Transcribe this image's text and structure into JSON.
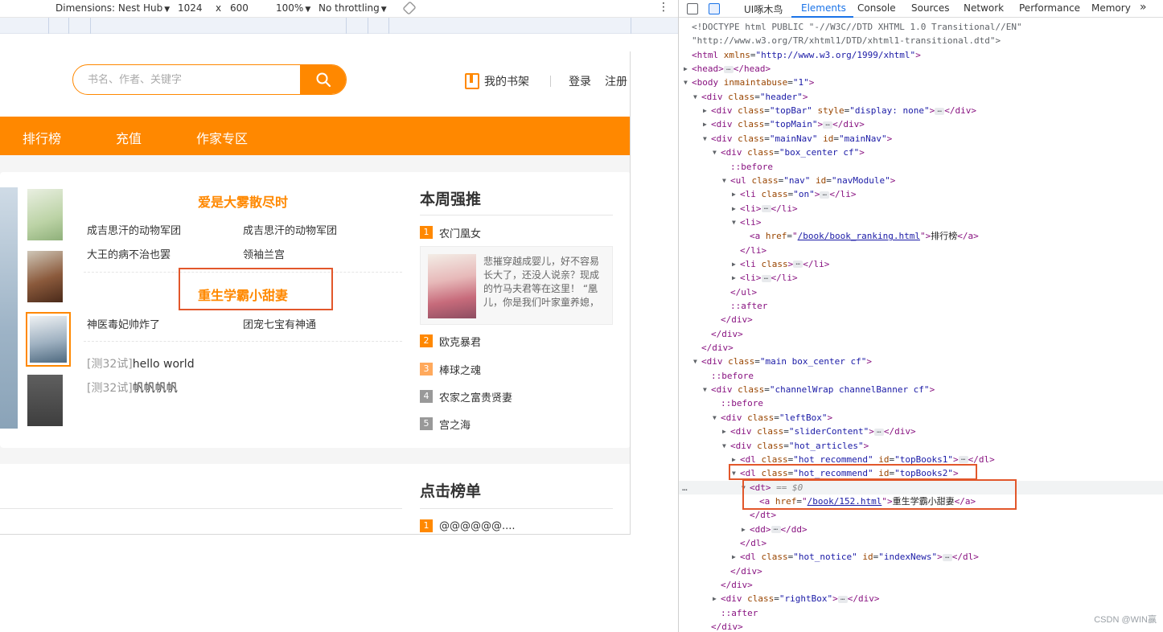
{
  "device_toolbar": {
    "dimensions_label": "Dimensions: Nest Hub",
    "width": "1024",
    "times": "x",
    "height": "600",
    "zoom": "100%",
    "throttling": "No throttling",
    "more": "⋮"
  },
  "site": {
    "search_placeholder": "书名、作者、关键字",
    "bookshelf_label": "我的书架",
    "login_label": "登录",
    "register_label": "注册",
    "nav": [
      {
        "label": "排行榜"
      },
      {
        "label": "充值"
      },
      {
        "label": "作家专区"
      }
    ],
    "hot_recommend_1": {
      "title": "爱是大雾散尽时",
      "books": [
        "成吉思汗的动物军团",
        "成吉思汗的动物军团",
        "大王的病不治也罢",
        "领袖兰宫"
      ]
    },
    "hot_recommend_2": {
      "title": "重生学霸小甜妻",
      "books": [
        "神医毒妃帅炸了",
        "团宠七宝有神通"
      ]
    },
    "notices": [
      {
        "tag": "[测32试]",
        "text": "hello world"
      },
      {
        "tag": "[测32试]",
        "text": "帆帆帆帆"
      }
    ],
    "weekly_recommend": {
      "title": "本周强推",
      "items": [
        {
          "rank": "1",
          "name": "农门凰女"
        },
        {
          "rank": "2",
          "name": "欧克暴君"
        },
        {
          "rank": "3",
          "name": "棒球之魂"
        },
        {
          "rank": "4",
          "name": "农家之富贵贤妻"
        },
        {
          "rank": "5",
          "name": "宫之海"
        }
      ],
      "feature_desc": "悲摧穿越成婴儿，好不容易长大了，还没人说亲？现成的竹马夫君等在这里！ “凰儿，你是我们叶家童养媳，"
    },
    "click_rank": {
      "title": "点击榜单",
      "items": [
        {
          "rank": "1",
          "name": "@@@@@@...."
        }
      ]
    }
  },
  "devtools": {
    "tabs": [
      "UI啄木鸟",
      "Elements",
      "Console",
      "Sources",
      "Network",
      "Performance",
      "Memory"
    ],
    "more_tabs": "»",
    "lines": [
      {
        "i": 0,
        "a": "",
        "h": "<span class='doc-c'>&lt;!DOCTYPE html PUBLIC \"-//W3C//DTD XHTML 1.0 Transitional//EN\"</span>"
      },
      {
        "i": 0,
        "a": "",
        "h": "<span class='doc-c'>\"http://www.w3.org/TR/xhtml1/DTD/xhtml1-transitional.dtd\"&gt;</span>"
      },
      {
        "i": 0,
        "a": "",
        "h": "<span class='tag-c'>&lt;html</span> <span class='attr-n'>xmlns</span>=<span class='attr-v'>\"http://www.w3.org/1999/xhtml\"</span><span class='tag-c'>&gt;</span>"
      },
      {
        "i": 0,
        "a": "▶",
        "h": "<span class='tag-c'>&lt;head&gt;</span><span class='ell'>…</span><span class='tag-c'>&lt;/head&gt;</span>"
      },
      {
        "i": 0,
        "a": "▼",
        "h": "<span class='tag-c'>&lt;body</span> <span class='attr-n'>inmaintabuse</span>=<span class='attr-v'>\"1\"</span><span class='tag-c'>&gt;</span>"
      },
      {
        "i": 1,
        "a": "▼",
        "h": "<span class='tag-c'>&lt;div</span> <span class='attr-n'>class</span>=<span class='attr-v'>\"header\"</span><span class='tag-c'>&gt;</span>"
      },
      {
        "i": 2,
        "a": "▶",
        "h": "<span class='tag-c'>&lt;div</span> <span class='attr-n'>class</span>=<span class='attr-v'>\"topBar\"</span> <span class='attr-n'>style</span>=<span class='attr-v'>\"display: none\"</span><span class='tag-c'>&gt;</span><span class='ell'>…</span><span class='tag-c'>&lt;/div&gt;</span>"
      },
      {
        "i": 2,
        "a": "▶",
        "h": "<span class='tag-c'>&lt;div</span> <span class='attr-n'>class</span>=<span class='attr-v'>\"topMain\"</span><span class='tag-c'>&gt;</span><span class='ell'>…</span><span class='tag-c'>&lt;/div&gt;</span>"
      },
      {
        "i": 2,
        "a": "▼",
        "h": "<span class='tag-c'>&lt;div</span> <span class='attr-n'>class</span>=<span class='attr-v'>\"mainNav\"</span> <span class='attr-n'>id</span>=<span class='attr-v'>\"mainNav\"</span><span class='tag-c'>&gt;</span>"
      },
      {
        "i": 3,
        "a": "▼",
        "h": "<span class='tag-c'>&lt;div</span> <span class='attr-n'>class</span>=<span class='attr-v'>\"box_center cf\"</span><span class='tag-c'>&gt;</span>"
      },
      {
        "i": 4,
        "a": "",
        "h": "<span class='pseudo'>::before</span>"
      },
      {
        "i": 4,
        "a": "▼",
        "h": "<span class='tag-c'>&lt;ul</span> <span class='attr-n'>class</span>=<span class='attr-v'>\"nav\"</span> <span class='attr-n'>id</span>=<span class='attr-v'>\"navModule\"</span><span class='tag-c'>&gt;</span>"
      },
      {
        "i": 5,
        "a": "▶",
        "h": "<span class='tag-c'>&lt;li</span> <span class='attr-n'>class</span>=<span class='attr-v'>\"on\"</span><span class='tag-c'>&gt;</span><span class='ell'>…</span><span class='tag-c'>&lt;/li&gt;</span>"
      },
      {
        "i": 5,
        "a": "▶",
        "h": "<span class='tag-c'>&lt;li&gt;</span><span class='ell'>…</span><span class='tag-c'>&lt;/li&gt;</span>"
      },
      {
        "i": 5,
        "a": "▼",
        "h": "<span class='tag-c'>&lt;li&gt;</span>"
      },
      {
        "i": 6,
        "a": "",
        "h": "<span class='tag-c'>&lt;a</span> <span class='attr-n'>href</span>=<span class='tag-c'>\"</span><span class='link-c'>/book/book_ranking.html</span><span class='tag-c'>\"&gt;</span><span class='plain-c'>排行榜</span><span class='tag-c'>&lt;/a&gt;</span>"
      },
      {
        "i": 5,
        "a": "",
        "h": "<span class='tag-c'>&lt;/li&gt;</span>"
      },
      {
        "i": 5,
        "a": "▶",
        "h": "<span class='tag-c'>&lt;li</span> <span class='attr-n'>class</span><span class='tag-c'>&gt;</span><span class='ell'>…</span><span class='tag-c'>&lt;/li&gt;</span>"
      },
      {
        "i": 5,
        "a": "▶",
        "h": "<span class='tag-c'>&lt;li&gt;</span><span class='ell'>…</span><span class='tag-c'>&lt;/li&gt;</span>"
      },
      {
        "i": 4,
        "a": "",
        "h": "<span class='tag-c'>&lt;/ul&gt;</span>"
      },
      {
        "i": 4,
        "a": "",
        "h": "<span class='pseudo'>::after</span>"
      },
      {
        "i": 3,
        "a": "",
        "h": "<span class='tag-c'>&lt;/div&gt;</span>"
      },
      {
        "i": 2,
        "a": "",
        "h": "<span class='tag-c'>&lt;/div&gt;</span>"
      },
      {
        "i": 1,
        "a": "",
        "h": "<span class='tag-c'>&lt;/div&gt;</span>"
      },
      {
        "i": 1,
        "a": "▼",
        "h": "<span class='tag-c'>&lt;div</span> <span class='attr-n'>class</span>=<span class='attr-v'>\"main box_center cf\"</span><span class='tag-c'>&gt;</span>"
      },
      {
        "i": 2,
        "a": "",
        "h": "<span class='pseudo'>::before</span>"
      },
      {
        "i": 2,
        "a": "▼",
        "h": "<span class='tag-c'>&lt;div</span> <span class='attr-n'>class</span>=<span class='attr-v'>\"channelWrap channelBanner cf\"</span><span class='tag-c'>&gt;</span>"
      },
      {
        "i": 3,
        "a": "",
        "h": "<span class='pseudo'>::before</span>"
      },
      {
        "i": 3,
        "a": "▼",
        "h": "<span class='tag-c'>&lt;div</span> <span class='attr-n'>class</span>=<span class='attr-v'>\"leftBox\"</span><span class='tag-c'>&gt;</span>"
      },
      {
        "i": 4,
        "a": "▶",
        "h": "<span class='tag-c'>&lt;div</span> <span class='attr-n'>class</span>=<span class='attr-v'>\"sliderContent\"</span><span class='tag-c'>&gt;</span><span class='ell'>…</span><span class='tag-c'>&lt;/div&gt;</span>"
      },
      {
        "i": 4,
        "a": "▼",
        "h": "<span class='tag-c'>&lt;div</span> <span class='attr-n'>class</span>=<span class='attr-v'>\"hot_articles\"</span><span class='tag-c'>&gt;</span>"
      },
      {
        "i": 5,
        "a": "▶",
        "h": "<span class='tag-c'>&lt;dl</span> <span class='attr-n'>class</span>=<span class='attr-v'>\"hot_recommend\"</span> <span class='attr-n'>id</span>=<span class='attr-v'>\"topBooks1\"</span><span class='tag-c'>&gt;</span><span class='ell'>…</span><span class='tag-c'>&lt;/dl&gt;</span>"
      },
      {
        "i": 5,
        "a": "▼",
        "h": "<span class='tag-c'>&lt;dl</span> <span class='attr-n'>class</span>=<span class='attr-v'>\"hot_recommend\"</span> <span class='attr-n'>id</span>=<span class='attr-v'>\"topBooks2\"</span><span class='tag-c'>&gt;</span>"
      },
      {
        "i": 6,
        "a": "▼",
        "h": "<span class='tag-c'>&lt;dt&gt;</span> <span class='dim-c'>== $0</span>",
        "sel": true
      },
      {
        "i": 7,
        "a": "",
        "h": "<span class='tag-c'>&lt;a</span> <span class='attr-n'>href</span>=<span class='tag-c'>\"</span><span class='link-c'>/book/152.html</span><span class='tag-c'>\"&gt;</span><span class='plain-c'>重生学霸小甜妻</span><span class='tag-c'>&lt;/a&gt;</span>"
      },
      {
        "i": 6,
        "a": "",
        "h": "<span class='tag-c'>&lt;/dt&gt;</span>"
      },
      {
        "i": 6,
        "a": "▶",
        "h": "<span class='tag-c'>&lt;dd&gt;</span><span class='ell'>…</span><span class='tag-c'>&lt;/dd&gt;</span>"
      },
      {
        "i": 5,
        "a": "",
        "h": "<span class='tag-c'>&lt;/dl&gt;</span>"
      },
      {
        "i": 5,
        "a": "▶",
        "h": "<span class='tag-c'>&lt;dl</span> <span class='attr-n'>class</span>=<span class='attr-v'>\"hot_notice\"</span> <span class='attr-n'>id</span>=<span class='attr-v'>\"indexNews\"</span><span class='tag-c'>&gt;</span><span class='ell'>…</span><span class='tag-c'>&lt;/dl&gt;</span>"
      },
      {
        "i": 4,
        "a": "",
        "h": "<span class='tag-c'>&lt;/div&gt;</span>"
      },
      {
        "i": 3,
        "a": "",
        "h": "<span class='tag-c'>&lt;/div&gt;</span>"
      },
      {
        "i": 3,
        "a": "▶",
        "h": "<span class='tag-c'>&lt;div</span> <span class='attr-n'>class</span>=<span class='attr-v'>\"rightBox\"</span><span class='tag-c'>&gt;</span><span class='ell'>…</span><span class='tag-c'>&lt;/div&gt;</span>"
      },
      {
        "i": 3,
        "a": "",
        "h": "<span class='pseudo'>::after</span>"
      },
      {
        "i": 2,
        "a": "",
        "h": "<span class='tag-c'>&lt;/div&gt;</span>"
      }
    ],
    "selected_dots": "…",
    "watermark": "CSDN @WIN赢"
  },
  "colors": {
    "brand_orange": "#ff8800",
    "highlight_red": "#e2572b",
    "rank_orange": "#ff8800",
    "rank_light": "#ffa95c",
    "rank_gray": "#999999",
    "devtools_accent": "#1a73e8"
  },
  "icons": {
    "search": "search-icon",
    "bookshelf": "bookshelf-icon",
    "more": "more-vertical-icon",
    "inspect": "inspect-element-icon",
    "device": "device-toggle-icon",
    "rotate": "rotate-icon"
  }
}
